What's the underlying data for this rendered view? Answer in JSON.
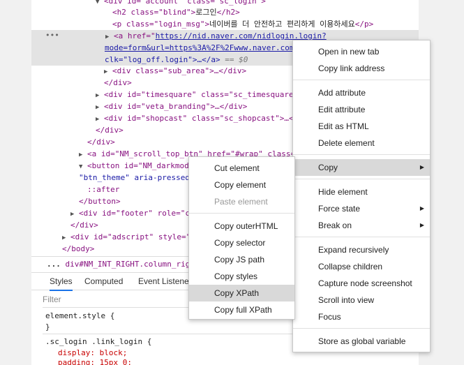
{
  "code_lines": [
    {
      "tri": "▼",
      "html": "<span class=\"tag\">&lt;div</span> <span class=\"attr\">id</span>=<span class=\"val\">\"account\"</span> <span class=\"attr\">class</span>=<span class=\"val\">\"sc_login\"</span><span class=\"tag\">&gt;</span>"
    },
    {
      "tri": "",
      "text": ""
    },
    {
      "tri": "",
      "text": ""
    }
  ],
  "code": {
    "l0a": "<div id=\"account\" class=\"sc_login\">",
    "l1a": "<h2 class=\"blind\">",
    "l1b": "로그인",
    "l1c": "</h2>",
    "l2a": "<p class=\"login_msg\">",
    "l2b": "네이버를 더 안전하고 편리하게 이용하세요",
    "l2c": "</p>",
    "l3a": "<a href=\"",
    "l3b": "https://nid.naver.com/nidlogin.login?",
    "l4a": "mode=form&url=https%3A%2F%2Fwww.naver.com",
    "l5a": "clk=\"log_off.login\">…</a>",
    "l5b": " == $0",
    "l6": "<div class=\"sub_area\">…</div>",
    "l7": "</div>",
    "l8": "<div id=\"timesquare\" class=\"sc_timesquare",
    "l9": "<div id=\"veta_branding\">…</div>",
    "l10": "<div id=\"shopcast\" class=\"sc_shopcast\">…<",
    "l11": "</div>",
    "l12": "</div>",
    "l13": "<a id=\"NM_scroll_top_btn\" href=\"#wrap\" class=",
    "l14": "<button id=\"NM_darkmod",
    "l15": "\"btn_theme\" aria-pressed",
    "l16": "::after",
    "l17": "</button>",
    "l18": "<div id=\"footer\" role=\"c",
    "l19": "</div>",
    "l20": "<div id=\"adscript\" style=\"",
    "l21": "</body>"
  },
  "breadcrumb": {
    "dots": "...",
    "c1": "div#NM_INT_RIGHT",
    "c2": ".column_right"
  },
  "tabs": [
    "Styles",
    "Computed",
    "Event Listener"
  ],
  "filter_placeholder": "Filter",
  "styles": {
    "s1": "element.style {",
    "s2": "}",
    "s3": ".sc_login .link_login {",
    "s4": "display: block;",
    "s5": "padding: 15px 0;"
  },
  "main_menu": {
    "open_new_tab": "Open in new tab",
    "copy_link": "Copy link address",
    "add_attribute": "Add attribute",
    "edit_attribute": "Edit attribute",
    "edit_html": "Edit as HTML",
    "delete_element": "Delete element",
    "copy": "Copy",
    "hide_element": "Hide element",
    "force_state": "Force state",
    "break_on": "Break on",
    "expand_recursively": "Expand recursively",
    "collapse_children": "Collapse children",
    "capture_screenshot": "Capture node screenshot",
    "scroll_into_view": "Scroll into view",
    "focus": "Focus",
    "store_global": "Store as global variable"
  },
  "copy_menu": {
    "cut_element": "Cut element",
    "copy_element": "Copy element",
    "paste_element": "Paste element",
    "copy_outerhtml": "Copy outerHTML",
    "copy_selector": "Copy selector",
    "copy_js_path": "Copy JS path",
    "copy_styles": "Copy styles",
    "copy_xpath": "Copy XPath",
    "copy_full_xpath": "Copy full XPath"
  }
}
